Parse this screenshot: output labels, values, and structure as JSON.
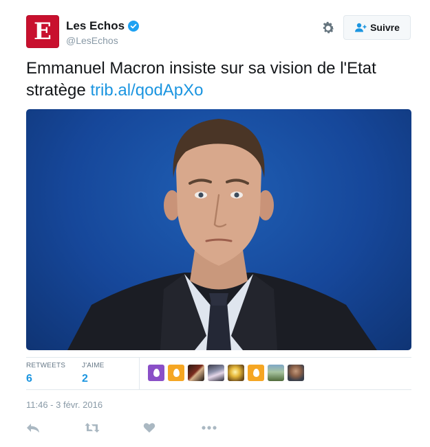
{
  "account": {
    "avatar_letter": "E",
    "display_name": "Les Echos",
    "handle": "@LesEchos",
    "verified": true
  },
  "header": {
    "settings_icon": "gear-icon",
    "follow_label": "Suivre",
    "follow_icon": "add-user-icon"
  },
  "tweet": {
    "text": "Emmanuel Macron insiste sur sa vision de l'Etat stratège",
    "link": "trib.al/qodApXo"
  },
  "stats": {
    "retweets_label": "RETWEETS",
    "retweets_value": "6",
    "likes_label": "J'AIME",
    "likes_value": "2"
  },
  "timestamp": "11:46 - 3 févr. 2016",
  "actions": [
    "reply-icon",
    "retweet-icon",
    "like-icon",
    "more-icon"
  ],
  "colors": {
    "link": "#1b95e0",
    "brand_red": "#c8102e",
    "muted": "#8899a6",
    "photo_background": "#16479a"
  }
}
